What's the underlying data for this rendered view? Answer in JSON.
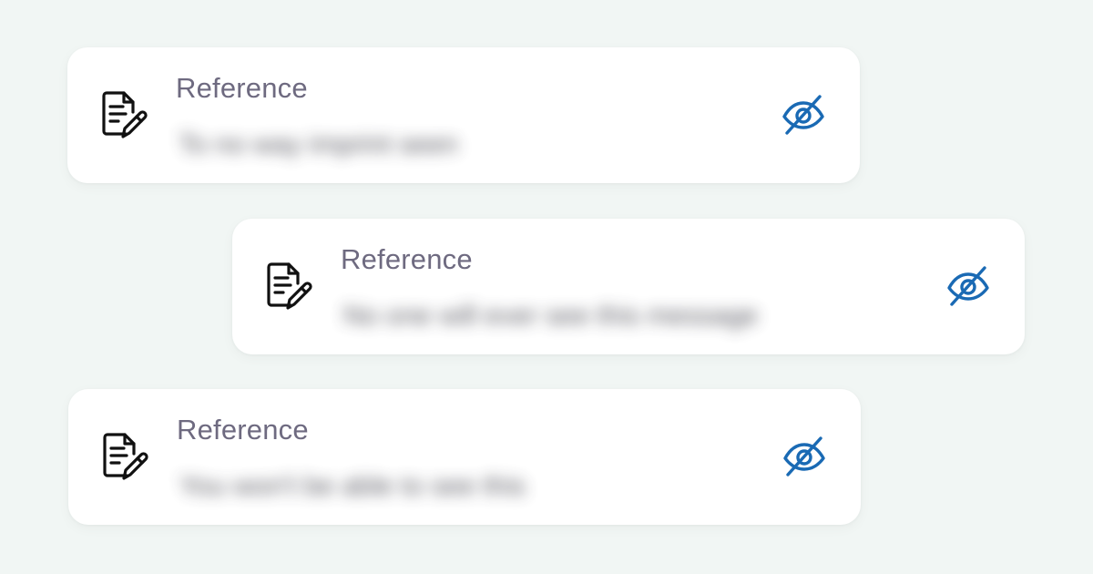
{
  "colors": {
    "background": "#f1f6f4",
    "card": "#ffffff",
    "label": "#6e6a80",
    "value": "#3a3a44",
    "accent": "#1a6ab4",
    "icon": "#111111"
  },
  "fields": [
    {
      "label": "Reference",
      "value": "To no way imprint seen",
      "value_hidden": true,
      "leading_icon": "document-edit-icon",
      "toggle_icon": "eye-off-icon"
    },
    {
      "label": "Reference",
      "value": "No one will ever see this message",
      "value_hidden": true,
      "leading_icon": "document-edit-icon",
      "toggle_icon": "eye-off-icon"
    },
    {
      "label": "Reference",
      "value": "You won't be able to see this",
      "value_hidden": true,
      "leading_icon": "document-edit-icon",
      "toggle_icon": "eye-off-icon"
    }
  ]
}
